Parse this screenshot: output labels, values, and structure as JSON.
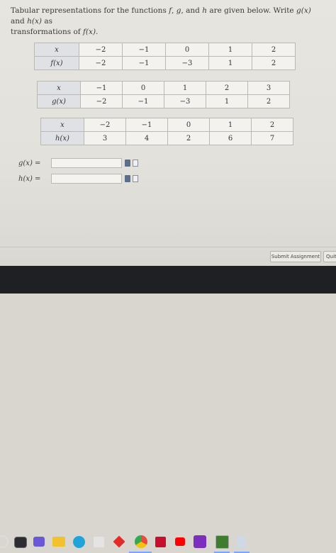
{
  "prompt": {
    "line1_a": "Tabular representations for the functions",
    "f": "f",
    "g": "g",
    "h": "h",
    "line1_b": "and",
    "line1_c": "are given below. Write",
    "gx": "g(x)",
    "and2": "and",
    "hx": "h(x)",
    "as": "as",
    "line2_a": "transformations of",
    "fx": "f(x)."
  },
  "tables": {
    "f": {
      "header": [
        "x",
        "−2",
        "−1",
        "0",
        "1",
        "2"
      ],
      "row": [
        "f(x)",
        "−2",
        "−1",
        "−3",
        "1",
        "2"
      ]
    },
    "g": {
      "header": [
        "x",
        "−1",
        "0",
        "1",
        "2",
        "3"
      ],
      "row": [
        "g(x)",
        "−2",
        "−1",
        "−3",
        "1",
        "2"
      ]
    },
    "h": {
      "header": [
        "x",
        "−2",
        "−1",
        "0",
        "1",
        "2"
      ],
      "row": [
        "h(x)",
        "3",
        "4",
        "2",
        "6",
        "7"
      ]
    }
  },
  "answers": {
    "g_label": "g(x) =",
    "h_label": "h(x) =",
    "g_value": "",
    "h_value": ""
  },
  "buttons": {
    "submit": "Submit Assignment",
    "quit": "Quit"
  },
  "taskbar": {
    "icons": [
      "start-icon",
      "search-icon",
      "video-call-icon",
      "folder-icon",
      "edge-icon",
      "calculator-icon",
      "ruby-icon",
      "chrome-icon",
      "mcafee-icon",
      "youtube-icon",
      "onenote-icon",
      "app-icon",
      "notepad-icon"
    ]
  }
}
